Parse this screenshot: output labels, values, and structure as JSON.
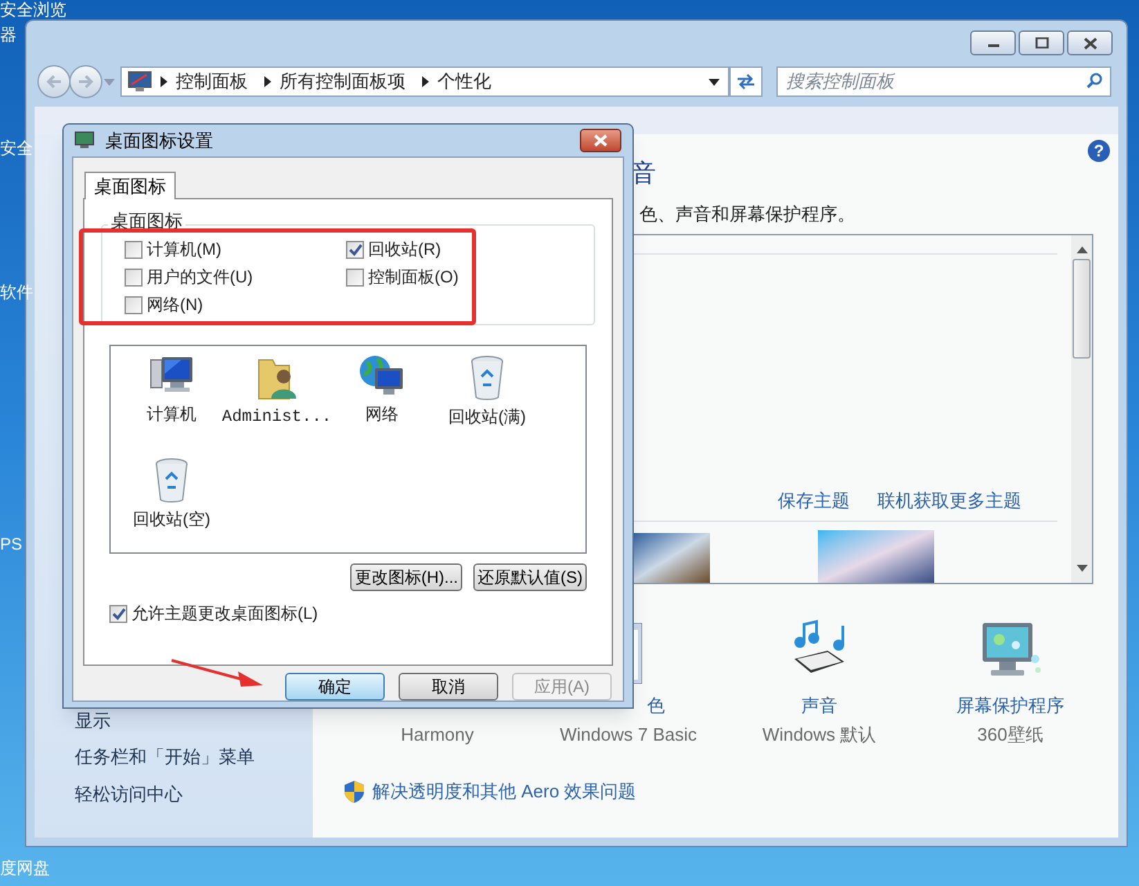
{
  "desktop_labels": [
    "安全浏览",
    "器",
    "安全",
    "软件",
    "PS",
    "度网盘"
  ],
  "window": {
    "breadcrumb": [
      "控制面板",
      "所有控制面板项",
      "个性化"
    ],
    "search": {
      "placeholder": "搜索控制面板"
    },
    "help_button": "?",
    "sidebar_links": [
      "显示",
      "任务栏和「开始」菜单",
      "轻松访问中心"
    ],
    "heading": "音",
    "description": "色、声音和屏幕保护程序。",
    "theme_links": [
      "保存主题",
      "联机获取更多主题"
    ],
    "settings": [
      {
        "kind": "background",
        "value": "Harmony"
      },
      {
        "kind": "color",
        "label": "色",
        "value": "Windows 7 Basic"
      },
      {
        "kind": "sound",
        "label": "声音",
        "value": "Windows 默认"
      },
      {
        "kind": "screensaver",
        "label": "屏幕保护程序",
        "value": "360壁纸"
      }
    ],
    "aero_link": "解决透明度和其他 Aero 效果问题"
  },
  "dialog": {
    "title": "桌面图标设置",
    "tabs": [
      {
        "label": "桌面图标",
        "selected": true
      }
    ],
    "group_title": "桌面图标",
    "checkboxes": [
      {
        "label": "计算机(M)",
        "checked": false
      },
      {
        "label": "回收站(R)",
        "checked": true
      },
      {
        "label": "用户的文件(U)",
        "checked": false
      },
      {
        "label": "控制面板(O)",
        "checked": false
      },
      {
        "label": "网络(N)",
        "checked": false
      }
    ],
    "icons": [
      {
        "kind": "computer",
        "label": "计算机"
      },
      {
        "kind": "user",
        "label": "Administ..."
      },
      {
        "kind": "network",
        "label": "网络"
      },
      {
        "kind": "bin",
        "label": "回收站(满)"
      },
      {
        "kind": "bin",
        "label": "回收站(空)"
      }
    ],
    "icon_buttons": [
      "更改图标(H)...",
      "还原默认值(S)"
    ],
    "allow_theme": {
      "label": "允许主题更改桌面图标(L)",
      "checked": true
    },
    "footer_buttons": [
      {
        "label": "确定",
        "default": true,
        "disabled": false
      },
      {
        "label": "取消",
        "default": false,
        "disabled": false
      },
      {
        "label": "应用(A)",
        "default": false,
        "disabled": true
      }
    ]
  }
}
